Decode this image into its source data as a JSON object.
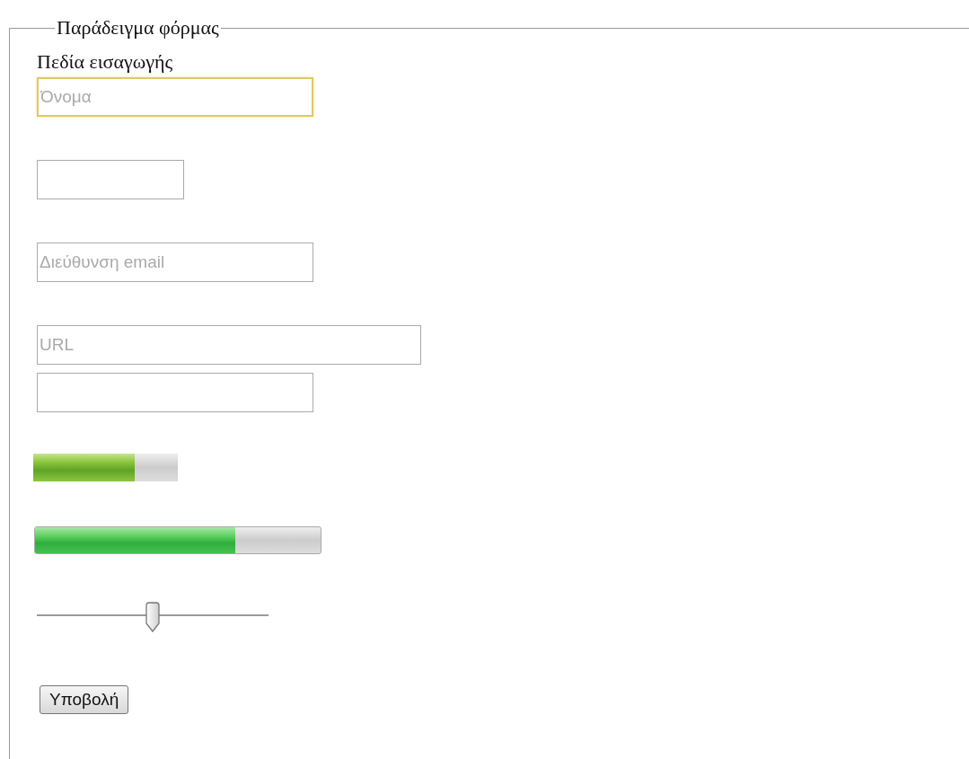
{
  "form": {
    "legend": "Παράδειγμα φόρμας",
    "heading": "Πεδία εισαγωγής",
    "controls": [
      {
        "kind": "text",
        "placeholder": "Όνομα",
        "focused": true
      },
      {
        "kind": "text",
        "focused": false
      },
      {
        "kind": "text",
        "placeholder": "Διεύθυνση email",
        "focused": false
      },
      {
        "kind": "text",
        "placeholder": "URL",
        "focused": false
      },
      {
        "kind": "text",
        "focused": false
      },
      {
        "kind": "meter",
        "level": 0.7
      },
      {
        "kind": "progress",
        "level": 0.7
      },
      {
        "kind": "range",
        "level": 0.5
      },
      {
        "kind": "button",
        "label": "Υποβολή"
      }
    ]
  }
}
